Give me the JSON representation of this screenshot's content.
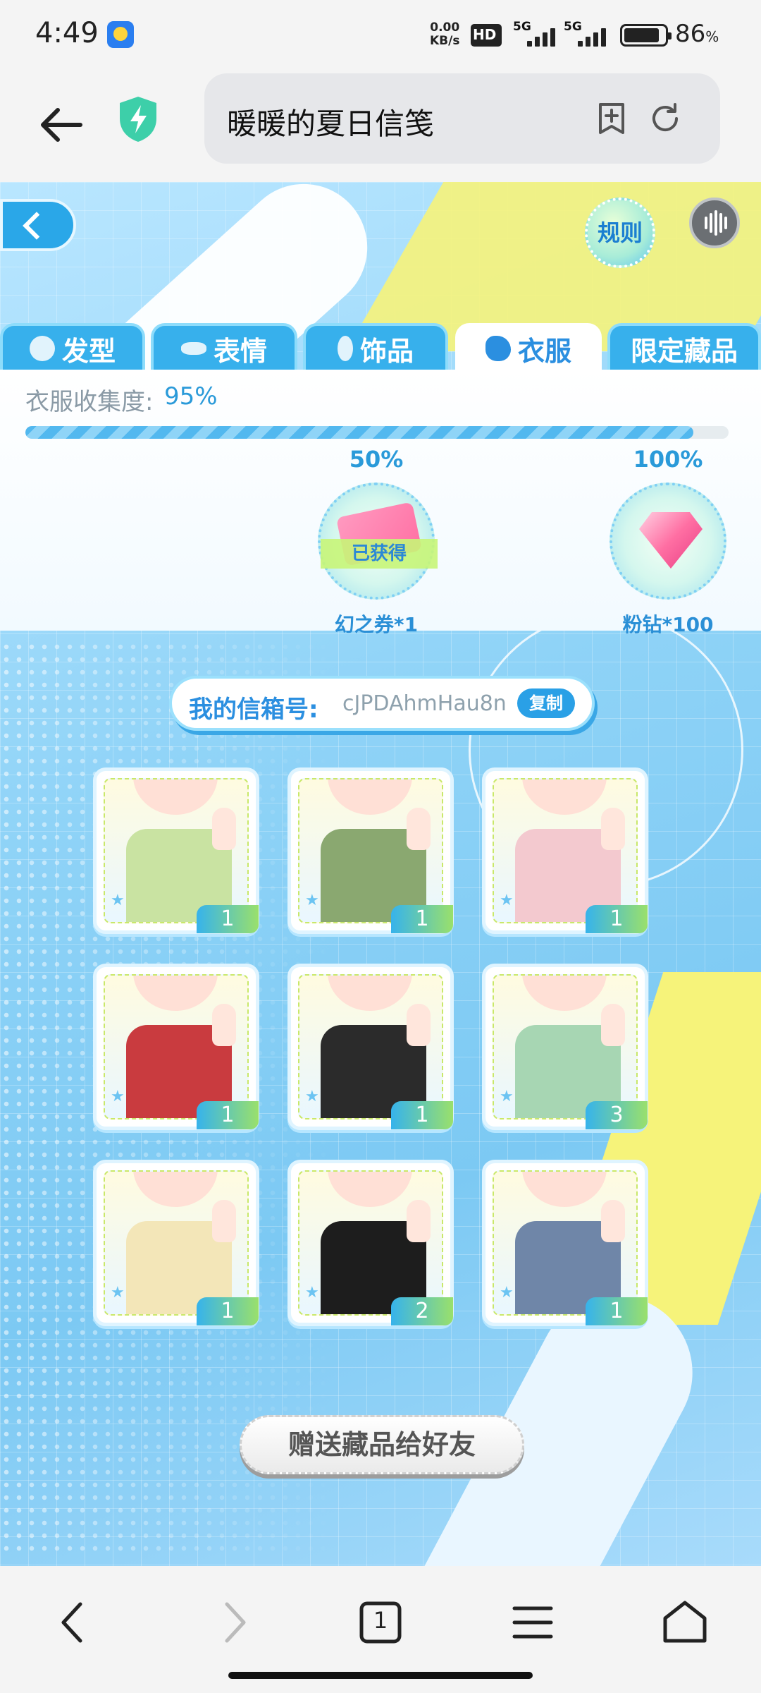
{
  "status_bar": {
    "time": "4:49",
    "net_speed_value": "0.00",
    "net_speed_unit": "KB/s",
    "hd_badge": "HD",
    "network_1": "5G",
    "network_2": "5G",
    "battery_percent": "86",
    "battery_unit": "%"
  },
  "browser": {
    "page_title": "暖暖的夏日信笺"
  },
  "game": {
    "rules_label": "规则",
    "tabs": [
      {
        "label": "发型",
        "icon": "hair-icon",
        "active": false
      },
      {
        "label": "表情",
        "icon": "mask-icon",
        "active": false
      },
      {
        "label": "饰品",
        "icon": "accessory-icon",
        "active": false
      },
      {
        "label": "衣服",
        "icon": "clothes-icon",
        "active": true
      },
      {
        "label": "限定藏品",
        "icon": "",
        "active": false
      }
    ],
    "collection": {
      "label": "衣服收集度:",
      "percent_text": "95%",
      "progress": 0.95
    },
    "milestones": [
      {
        "percent": "50%",
        "reward": "幻之券*1",
        "status": "已获得"
      },
      {
        "percent": "100%",
        "reward": "粉钻*100"
      }
    ],
    "mailbox": {
      "label": "我的信箱号:",
      "code": "cJPDAhmHau8n",
      "copy_label": "复制"
    },
    "items": [
      {
        "count": "1",
        "color": "#c9e3a2"
      },
      {
        "count": "1",
        "color": "#8aa870"
      },
      {
        "count": "1",
        "color": "#f3c9cf"
      },
      {
        "count": "1",
        "color": "#c93b3f"
      },
      {
        "count": "1",
        "color": "#2b2b2b"
      },
      {
        "count": "3",
        "color": "#a7d6b3"
      },
      {
        "count": "1",
        "color": "#f3e6b8"
      },
      {
        "count": "2",
        "color": "#1d1d1d"
      },
      {
        "count": "1",
        "color": "#6f86a8"
      }
    ],
    "gift_button": "赠送藏品给好友"
  },
  "nav": {
    "tab_count": "1"
  },
  "colors": {
    "accent": "#2a9ad9",
    "game_bg": "#8fd3f7",
    "tab_bg": "#37b0ec"
  }
}
